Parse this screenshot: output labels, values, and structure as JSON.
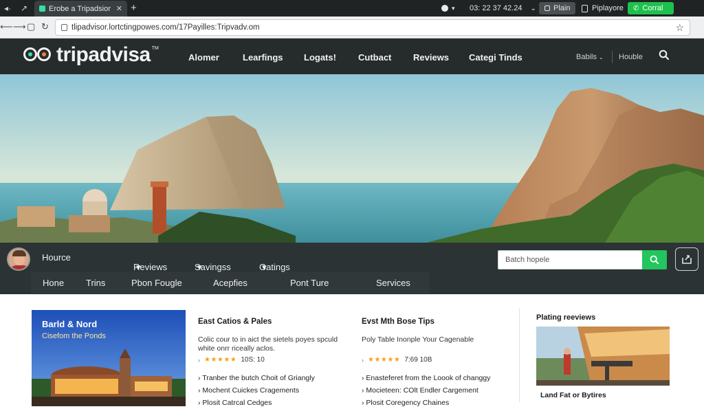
{
  "browser": {
    "tab_title": "Erobe a Tripadsior",
    "new_tab": "+",
    "clock": "03: 22 37 42.24",
    "plan_label": "Plain",
    "player_label": "Piplayore",
    "control_label": "Corral",
    "url": "tlipadvisor.lortctingpowes.com/17P̃ayilles:Tripvadv.om"
  },
  "site": {
    "logo_text": "tripadvisa",
    "logo_tm": "TM",
    "nav": [
      "Alomer",
      "Learfings",
      "Logats!",
      "Cutbact",
      "Reviews",
      "Categi Tinds"
    ],
    "right_links": [
      "Babils",
      "Houble"
    ]
  },
  "subnav": {
    "row1": [
      "Hource",
      "Reviews",
      "Savingss",
      "Gatings"
    ],
    "row2": [
      "Hone",
      "Trins",
      "Pbon Fougle",
      "Acepfies",
      "Pont Ture",
      "Services"
    ],
    "search_placeholder": "Batch hopele"
  },
  "content": {
    "card1": {
      "title": "Barld & Nord",
      "subtitle": "Cisefom the Ponds"
    },
    "col1": {
      "title": "East Catios & Pales",
      "desc": "Colic cour to in aict the sietels poyes spculd white onrr riceally aclos.",
      "rating": 5,
      "rating_text": "10S: 10",
      "items": [
        "Tranber the butch Choit of Griangly",
        "Mochent Cuickes Cragements",
        "Plosit Catrcal Cedges"
      ]
    },
    "col2": {
      "title": "Evst Mth Bose Tips",
      "desc": "Poly Table Inonple Your Cagenable",
      "rating": 5,
      "rating_text": "7:69 10B",
      "items": [
        "Enasteferet from the Loook of changgy",
        "Mocieteen: COlt Endler Cargement",
        "Plosit Coregency Chaines"
      ]
    },
    "side": {
      "title": "Plating reeviews",
      "caption": "Land Fat or Bytires"
    }
  },
  "colors": {
    "header_bg": "#262b2c",
    "accent_green": "#22c55e",
    "brand_green": "#34e0a1",
    "star": "#f4a21a"
  }
}
